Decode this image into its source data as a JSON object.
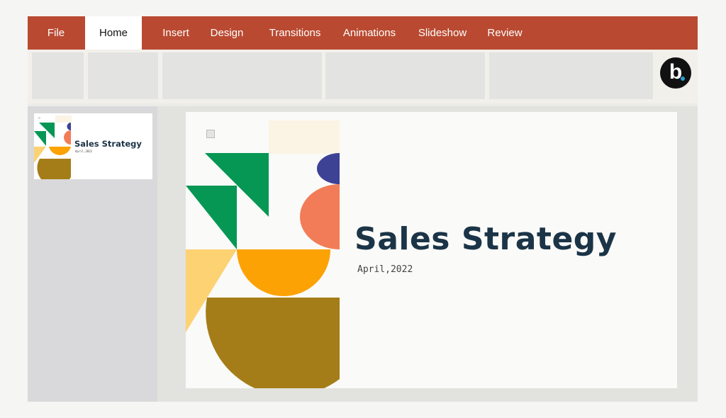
{
  "tabs": [
    {
      "label": "File"
    },
    {
      "label": "Home"
    },
    {
      "label": "Insert"
    },
    {
      "label": "Design"
    },
    {
      "label": "Transitions"
    },
    {
      "label": "Animations"
    },
    {
      "label": "Slideshow"
    },
    {
      "label": "Review"
    }
  ],
  "active_tab": "Home",
  "logo": {
    "letter": "b"
  },
  "slide": {
    "title": "Sales Strategy",
    "date": "April,2022"
  },
  "thumbnail": {
    "title": "Sales Strategy",
    "date": "April,2022"
  },
  "colors": {
    "tabbar": "#b94a31",
    "title_text": "#1b3447",
    "shape_green": "#079754",
    "shape_navy": "#3d4294",
    "shape_coral": "#f27c57",
    "shape_orange": "#fca204",
    "shape_yellow": "#fcd273",
    "shape_olive": "#a57d18",
    "shape_cream": "#fbf4e5"
  }
}
